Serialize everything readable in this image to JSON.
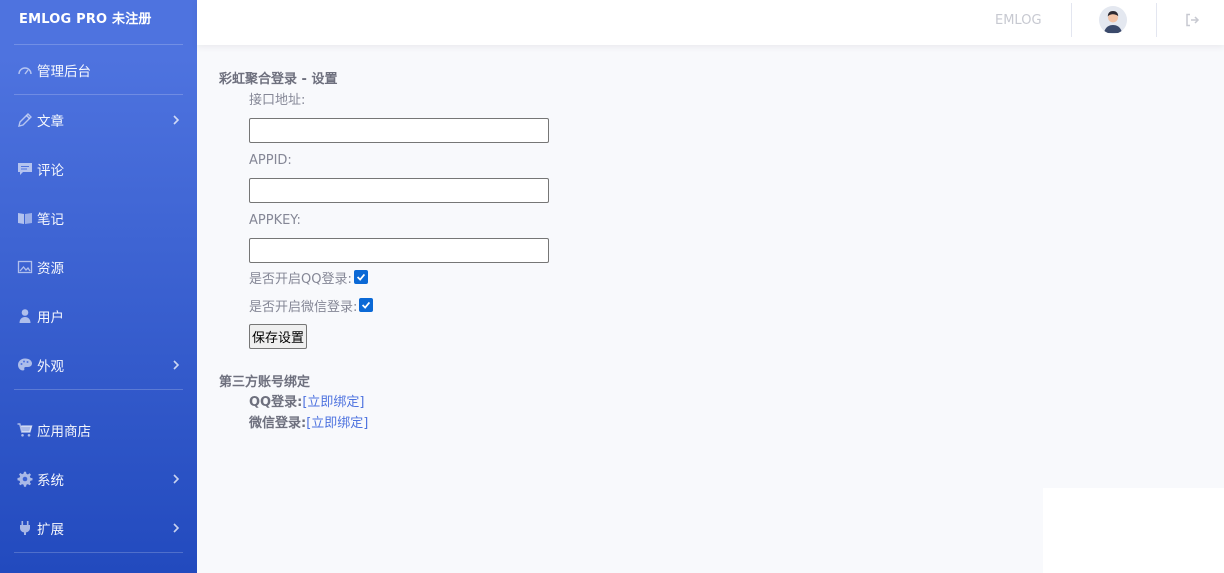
{
  "brand": {
    "title": "EMLOG PRO 未注册"
  },
  "sidebar": {
    "items": [
      {
        "label": "管理后台",
        "icon": "dashboard-icon",
        "has_submenu": false
      },
      {
        "label": "文章",
        "icon": "pencil-icon",
        "has_submenu": true
      },
      {
        "label": "评论",
        "icon": "comment-icon",
        "has_submenu": false
      },
      {
        "label": "笔记",
        "icon": "note-icon",
        "has_submenu": false
      },
      {
        "label": "资源",
        "icon": "image-icon",
        "has_submenu": false
      },
      {
        "label": "用户",
        "icon": "user-icon",
        "has_submenu": false
      },
      {
        "label": "外观",
        "icon": "palette-icon",
        "has_submenu": true
      },
      {
        "label": "应用商店",
        "icon": "cart-icon",
        "has_submenu": false
      },
      {
        "label": "系统",
        "icon": "gear-icon",
        "has_submenu": true
      },
      {
        "label": "扩展",
        "icon": "plug-icon",
        "has_submenu": true
      }
    ]
  },
  "topbar": {
    "site_label": "EMLOG"
  },
  "settings": {
    "title": "彩虹聚合登录 - 设置",
    "api_label": "接口地址:",
    "api_value": "",
    "appid_label": "APPID:",
    "appid_value": "",
    "appkey_label": "APPKEY:",
    "appkey_value": "",
    "qq_enable_label": "是否开启QQ登录:",
    "qq_enabled": true,
    "wechat_enable_label": "是否开启微信登录:",
    "wechat_enabled": true,
    "save_label": "保存设置"
  },
  "binding": {
    "title": "第三方账号绑定",
    "rows": [
      {
        "label": "QQ登录:",
        "link": "[立即绑定]"
      },
      {
        "label": "微信登录:",
        "link": "[立即绑定]"
      }
    ]
  },
  "colors": {
    "sidebar_top": "#4e73df",
    "sidebar_bottom": "#224abe",
    "link": "#4e73df",
    "checkbox": "#0b69d6"
  }
}
